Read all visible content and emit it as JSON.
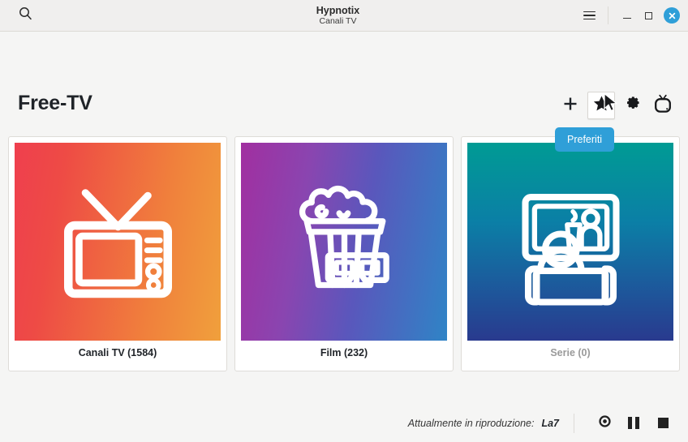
{
  "titlebar": {
    "search_icon": "search-icon",
    "title": "Hypnotix",
    "subtitle": "Canali TV",
    "menu_icon": "hamburger-menu-icon",
    "minimize_icon": "minimize-icon",
    "maximize_icon": "maximize-icon",
    "close_icon": "close-icon",
    "close_color": "#2f9fd8"
  },
  "header": {
    "title": "Free-TV",
    "tools": [
      {
        "name": "add-button",
        "icon": "plus-icon",
        "hovered": false
      },
      {
        "name": "favorites-button",
        "icon": "star-icon",
        "hovered": true
      },
      {
        "name": "preferences-button",
        "icon": "gear-icon",
        "hovered": false
      },
      {
        "name": "tv-channels-button",
        "icon": "tv-icon",
        "hovered": false
      }
    ]
  },
  "tooltip": {
    "text": "Preferiti",
    "background": "#2f9fd8"
  },
  "cards": [
    {
      "name": "canali-tv",
      "label": "Canali TV (1584)",
      "icon": "retro-tv-icon",
      "disabled": false,
      "gradient_from": "#ef3f4e",
      "gradient_to": "#f0a03c"
    },
    {
      "name": "film",
      "label": "Film (232)",
      "icon": "popcorn-3d-glasses-icon",
      "disabled": false,
      "gradient_from": "#a12fa0",
      "gradient_to": "#2f84c6"
    },
    {
      "name": "serie",
      "label": "Serie (0)",
      "icon": "person-watching-tv-icon",
      "disabled": true,
      "gradient_from": "#009b94",
      "gradient_to": "#293a8e"
    }
  ],
  "player": {
    "now_playing_label": "Attualmente in riproduzione:",
    "now_playing_value": "La7",
    "controls": [
      {
        "name": "show-video-button",
        "icon": "eye-icon"
      },
      {
        "name": "pause-button",
        "icon": "pause-icon"
      },
      {
        "name": "stop-button",
        "icon": "stop-icon"
      }
    ]
  },
  "cursor": {
    "icon": "mouse-pointer-icon"
  }
}
